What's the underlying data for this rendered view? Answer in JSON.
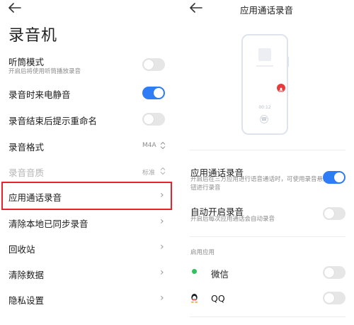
{
  "left": {
    "title": "录音机",
    "rows": [
      {
        "label": "听筒模式",
        "sub": "开启后将使用听筒播放录音",
        "toggle": false
      },
      {
        "label": "录音时来电静音",
        "toggle": true
      },
      {
        "label": "录音结束后提示重命名",
        "toggle": false
      },
      {
        "label": "录音格式",
        "value": "M4A"
      },
      {
        "label": "录音音质",
        "value": "标准"
      },
      {
        "label": "应用通话录音"
      },
      {
        "label": "清除本地已同步录音"
      },
      {
        "label": "回收站"
      },
      {
        "label": "清除数据"
      },
      {
        "label": "隐私设置"
      }
    ]
  },
  "right": {
    "title": "应用通话录音",
    "preview_timer": "00:12",
    "rows": [
      {
        "label": "应用通话录音",
        "sub": "开启后在三方应用进行语音通话时，可使用录音悬浮按钮进行录音",
        "toggle": true
      },
      {
        "label": "自动开启录音",
        "sub": "开启后每次应用通话会自动录音",
        "toggle": false
      }
    ],
    "section_title": "启用应用",
    "apps": [
      {
        "name": "微信",
        "toggle": false
      },
      {
        "name": "QQ",
        "toggle": false
      }
    ]
  },
  "colors": {
    "accent": "#2f7df6",
    "highlight": "#e8232b",
    "record": "#e8393b",
    "wechat": "#2bc45d"
  }
}
